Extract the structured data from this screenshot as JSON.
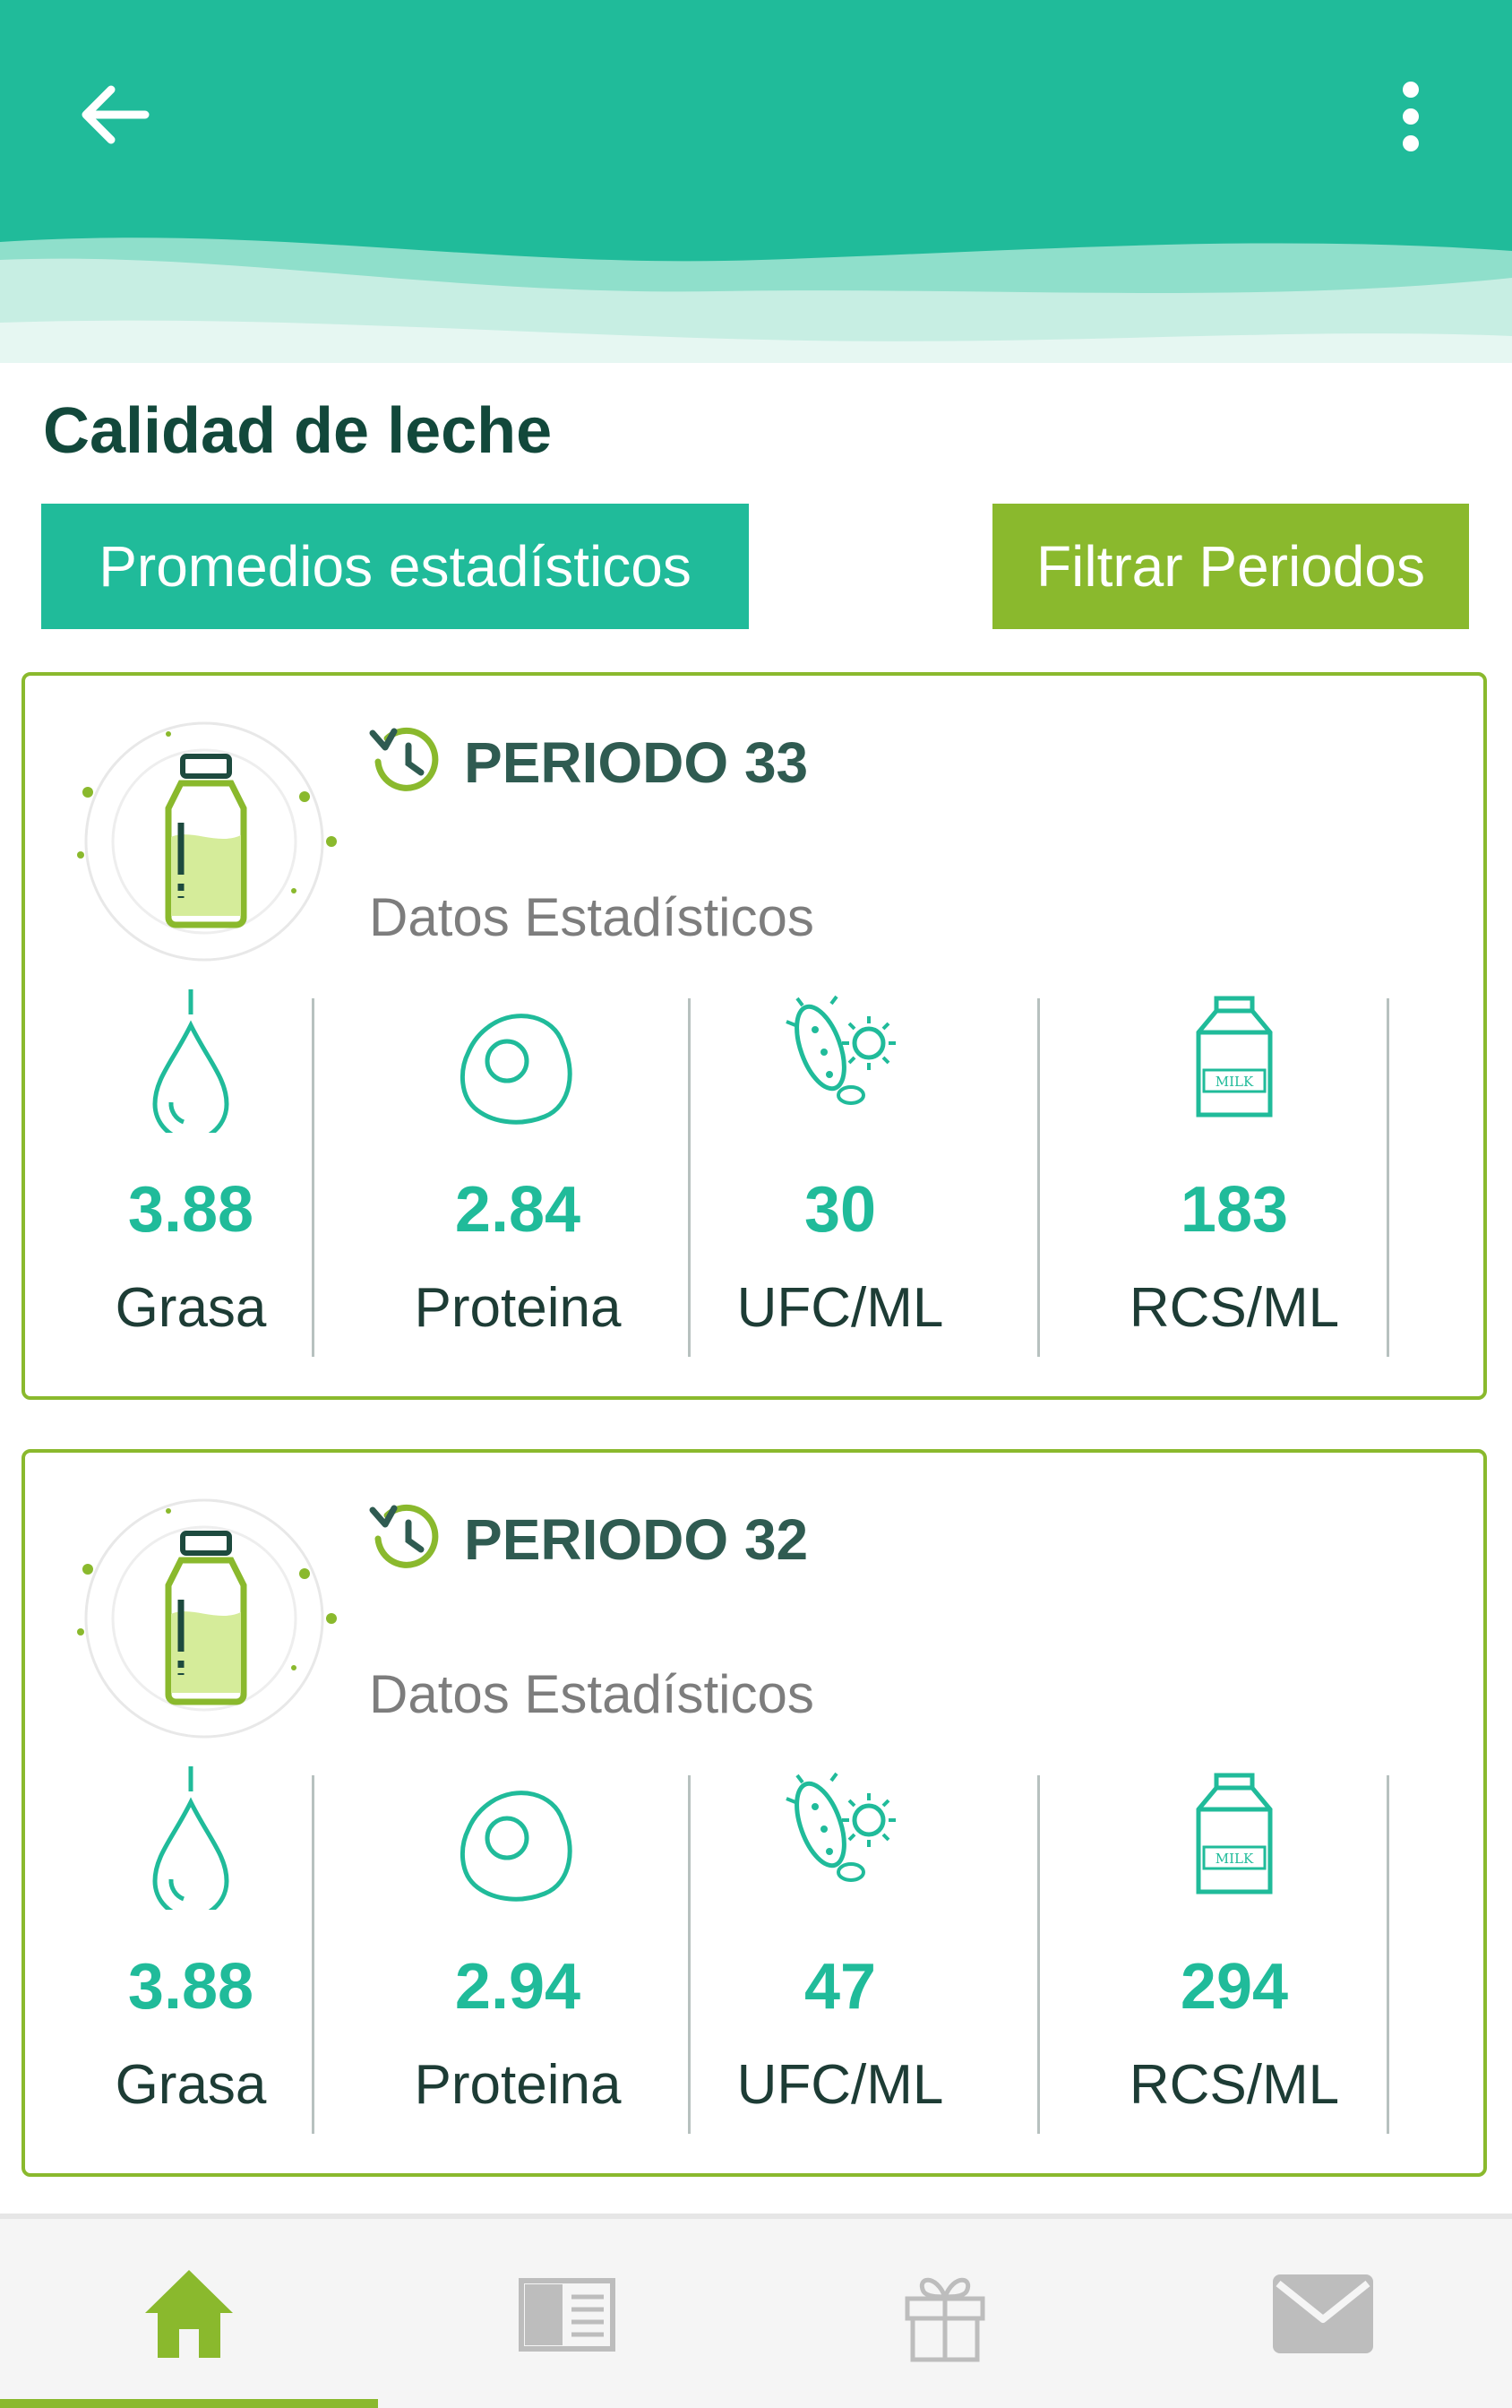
{
  "header": {
    "back_icon": "arrow-left-icon",
    "menu_icon": "more-vertical-icon",
    "color": "#20bb9a"
  },
  "page": {
    "title": "Calidad de leche",
    "buttons": {
      "promedios": "Promedios estadísticos",
      "filtrar": "Filtrar Periodos"
    }
  },
  "periods": [
    {
      "title": "PERIODO 33",
      "subtitle": "Datos Estadísticos",
      "stats": [
        {
          "value": "3.88",
          "label": "Grasa",
          "icon": "drop-icon"
        },
        {
          "value": "2.84",
          "label": "Proteina",
          "icon": "egg-icon"
        },
        {
          "value": "30",
          "label": "UFC/ML",
          "icon": "bacteria-icon"
        },
        {
          "value": "183",
          "label": "RCS/ML",
          "icon": "milk-carton-icon"
        }
      ]
    },
    {
      "title": "PERIODO 32",
      "subtitle": "Datos Estadísticos",
      "stats": [
        {
          "value": "3.88",
          "label": "Grasa",
          "icon": "drop-icon"
        },
        {
          "value": "2.94",
          "label": "Proteina",
          "icon": "egg-icon"
        },
        {
          "value": "47",
          "label": "UFC/ML",
          "icon": "bacteria-icon"
        },
        {
          "value": "294",
          "label": "RCS/ML",
          "icon": "milk-carton-icon"
        }
      ]
    }
  ],
  "milk_carton_text": "MILK",
  "bottom_nav": {
    "items": [
      {
        "icon": "home-icon",
        "active": true
      },
      {
        "icon": "newspaper-icon",
        "active": false
      },
      {
        "icon": "gift-icon",
        "active": false
      },
      {
        "icon": "mail-icon",
        "active": false
      }
    ],
    "active_color": "#8ab92d",
    "inactive_color": "#bdbdbd"
  }
}
